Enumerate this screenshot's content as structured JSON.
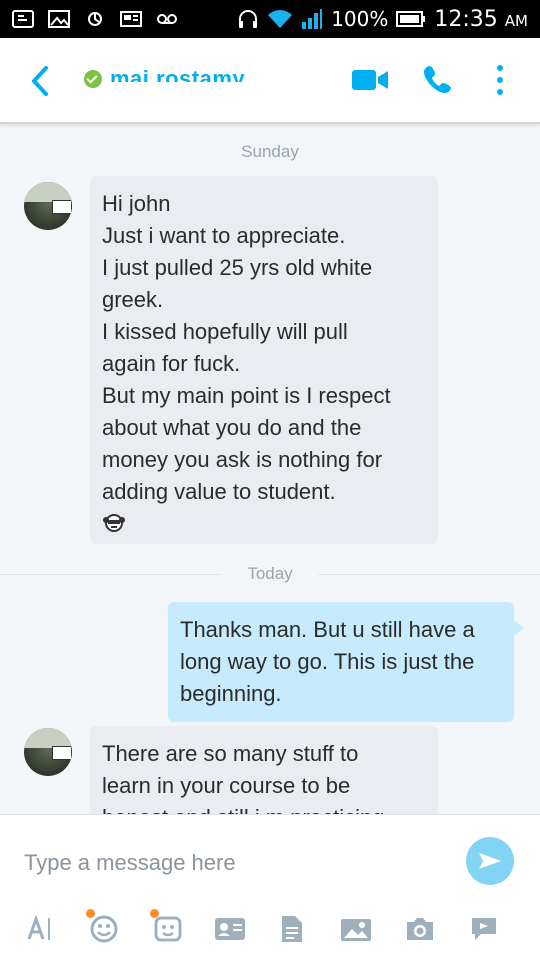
{
  "status_bar": {
    "battery": "100%",
    "time": "12:35",
    "ampm": "AM"
  },
  "header": {
    "contact_name": "mai rostamy",
    "presence": "online"
  },
  "chat": {
    "separators": [
      {
        "label": "Sunday"
      },
      {
        "label": "Today"
      }
    ],
    "messages": [
      {
        "direction": "incoming",
        "lines": [
          "Hi john",
          "Just i want to appreciate.",
          "I just pulled 25 yrs old white",
          "greek.",
          "I kissed hopefully will pull",
          "again for fuck.",
          "But my main point is I respect",
          "about what you do and the",
          "money you ask is nothing for",
          "adding value to student."
        ],
        "emoticon": "monkey-emoticon"
      },
      {
        "direction": "outgoing",
        "lines": [
          "Thanks man. But u still have a",
          "long way to go. This is just the",
          "beginning."
        ]
      },
      {
        "direction": "incoming",
        "lines": [
          "There are so many stuff to",
          "learn in your course to be",
          "honest and still i m practicing"
        ]
      }
    ]
  },
  "compose": {
    "placeholder": "Type a message here"
  },
  "colors": {
    "brand": "#00aff0",
    "incoming_bubble": "#e9edf2",
    "outgoing_bubble": "#c7eafc",
    "send_button": "#82d4f5",
    "notification_dot": "#ff8c2b",
    "presence_online": "#7dc242"
  }
}
